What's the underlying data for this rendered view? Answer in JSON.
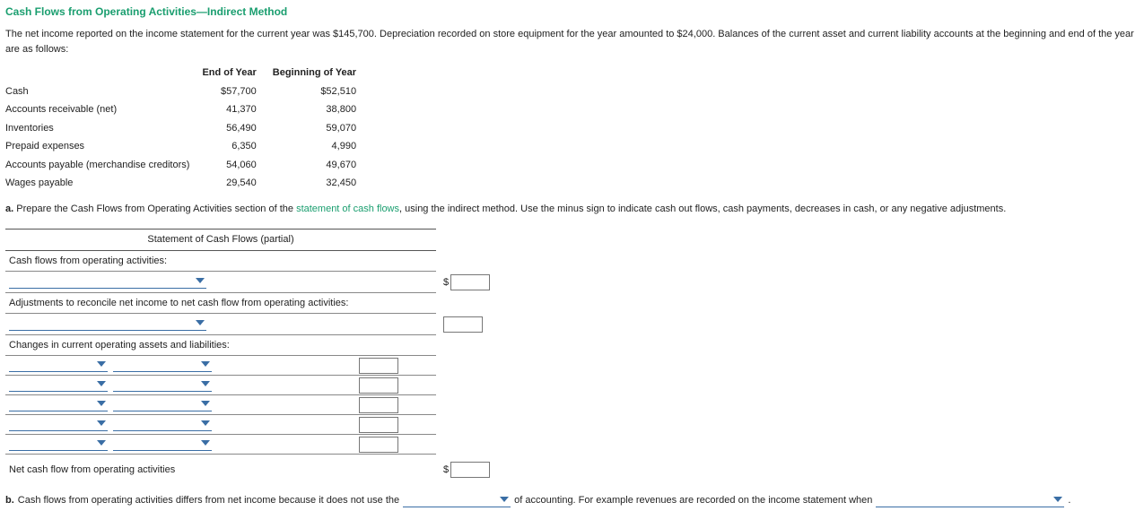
{
  "title": "Cash Flows from Operating Activities—Indirect Method",
  "intro": "The net income reported on the income statement for the current year was $145,700. Depreciation recorded on store equipment for the year amounted to $24,000. Balances of the current asset and current liability accounts at the beginning and end of the year are as follows:",
  "balances": {
    "headers": {
      "c1": "End of Year",
      "c2": "Beginning of Year"
    },
    "rows": [
      {
        "label": "Cash",
        "end": "$57,700",
        "beg": "$52,510"
      },
      {
        "label": "Accounts receivable (net)",
        "end": "41,370",
        "beg": "38,800"
      },
      {
        "label": "Inventories",
        "end": "56,490",
        "beg": "59,070"
      },
      {
        "label": "Prepaid expenses",
        "end": "6,350",
        "beg": "4,990"
      },
      {
        "label": "Accounts payable (merchandise creditors)",
        "end": "54,060",
        "beg": "49,670"
      },
      {
        "label": "Wages payable",
        "end": "29,540",
        "beg": "32,450"
      }
    ]
  },
  "qa": {
    "prefix": "a.",
    "text1": "Prepare the Cash Flows from Operating Activities section of the ",
    "link": "statement of cash flows",
    "text2": ", using the indirect method. Use the minus sign to indicate cash out flows, cash payments, decreases in cash, or any negative adjustments."
  },
  "scf": {
    "title": "Statement of Cash Flows (partial)",
    "line1": "Cash flows from operating activities:",
    "line_adj": "Adjustments to reconcile net income to net cash flow from operating activities:",
    "line_changes": "Changes in current operating assets and liabilities:",
    "net": "Net cash flow from operating activities"
  },
  "qb": {
    "prefix": "b.",
    "t1": "Cash flows from operating activities differs from net income because it does not use the",
    "t2": "of accounting. For example revenues are recorded on the income statement when",
    "t3": "."
  },
  "sym": {
    "dollar": "$"
  }
}
